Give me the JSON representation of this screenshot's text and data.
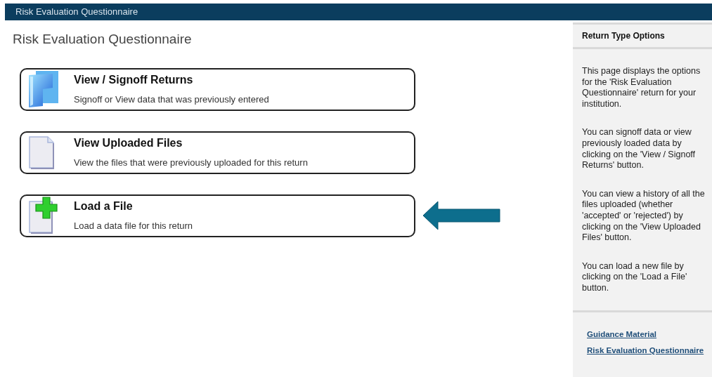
{
  "top_bar": {
    "title": "Risk Evaluation Questionnaire"
  },
  "page_title": "Risk Evaluation Questionnaire",
  "options": [
    {
      "kind": "folder",
      "title": "View / Signoff Returns",
      "description": "Signoff or View data that was previously entered",
      "pointed": false
    },
    {
      "kind": "document",
      "title": "View Uploaded Files",
      "description": "View the files that were previously uploaded for this return",
      "pointed": false
    },
    {
      "kind": "add-document",
      "title": "Load a File",
      "description": "Load a data file for this return",
      "pointed": true
    }
  ],
  "sidebar": {
    "title": "Return Type Options",
    "paragraphs": [
      "This page displays the options for the 'Risk Evaluation Questionnaire' return for your institution.",
      "You can signoff data or view previously loaded data by clicking on the 'View / Signoff Returns' button.",
      "You can view a history of all the files uploaded (whether 'accepted' or 'rejected') by clicking on the 'View Uploaded Files' button.",
      "You can load a new file by clicking on the 'Load a File' button."
    ],
    "links": [
      "Guidance Material",
      "Risk Evaluation Questionnaire"
    ]
  }
}
